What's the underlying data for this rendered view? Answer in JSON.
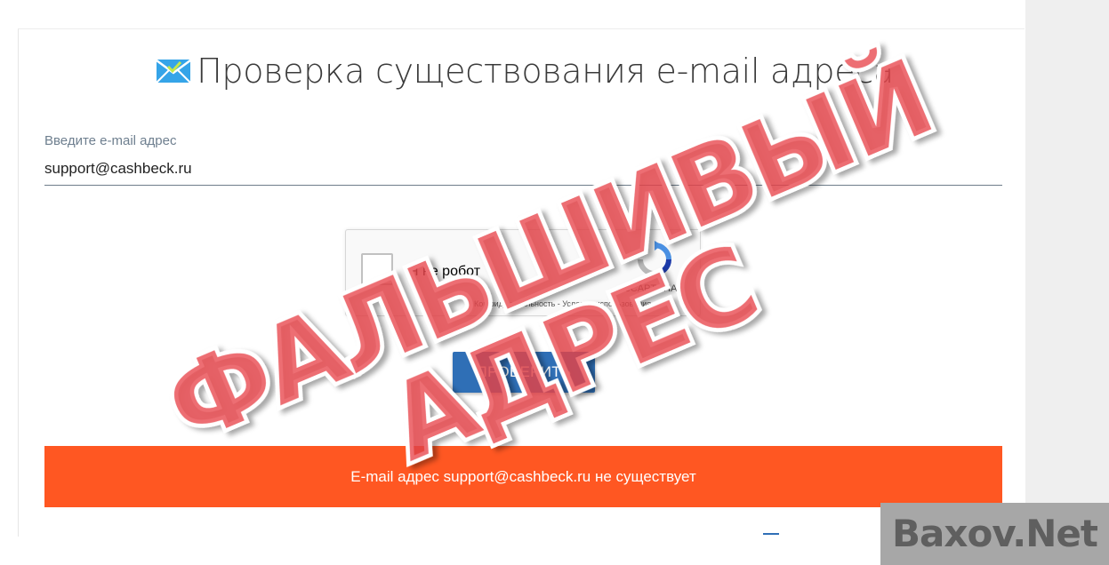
{
  "page": {
    "title": "Проверка существования e-mail адреса",
    "mail_icon": "envelope-check-icon"
  },
  "form": {
    "email_label": "Введите e-mail адрес",
    "email_value": "support@cashbeck.ru"
  },
  "captcha": {
    "checkbox_label": "Я не робот",
    "brand": "reCAPTCHA",
    "links": "Конфиденциальность - Условия использования"
  },
  "actions": {
    "check_label": "ПРОВЕРИТЬ"
  },
  "result": {
    "message": "E-mail адрес support@cashbeck.ru не существует"
  },
  "overlay": {
    "stamp_line1": "ФАЛЬШИВЫЙ",
    "stamp_line2": "АДРЕС",
    "watermark": "Baxov.Net"
  },
  "colors": {
    "accent_blue": "#2f6fb6",
    "error_orange": "#ff5722",
    "stamp_red": "#e8454c"
  }
}
